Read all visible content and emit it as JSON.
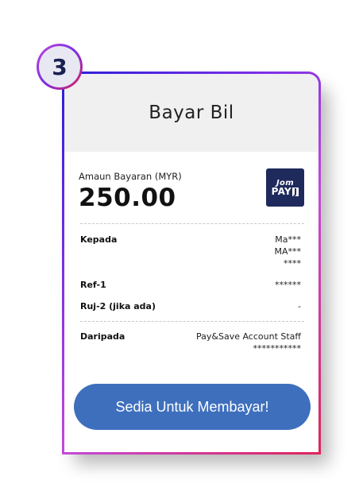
{
  "step": {
    "number": "3"
  },
  "header": {
    "title": "Bayar Bil"
  },
  "amount": {
    "label": "Amaun Bayaran (MYR)",
    "value": "250.00"
  },
  "logo": {
    "line1": "Jom",
    "line2": "PAY",
    "letter": "J"
  },
  "details": {
    "to": {
      "label": "Kepada",
      "lines": [
        "Ma***",
        "MA***",
        "****"
      ]
    },
    "ref1": {
      "label": "Ref-1",
      "value": "******"
    },
    "ref2": {
      "label": "Ruj-2 (jika ada)",
      "value": "-"
    },
    "from": {
      "label": "Daripada",
      "lines": [
        "Pay&Save Account Staff",
        "***********"
      ]
    }
  },
  "button": {
    "label": "Sedia Untuk Membayar!"
  },
  "colors": {
    "button": "#3e6fbd",
    "jompay": "#1e2a5c",
    "header_bg": "#f0f0f0"
  }
}
